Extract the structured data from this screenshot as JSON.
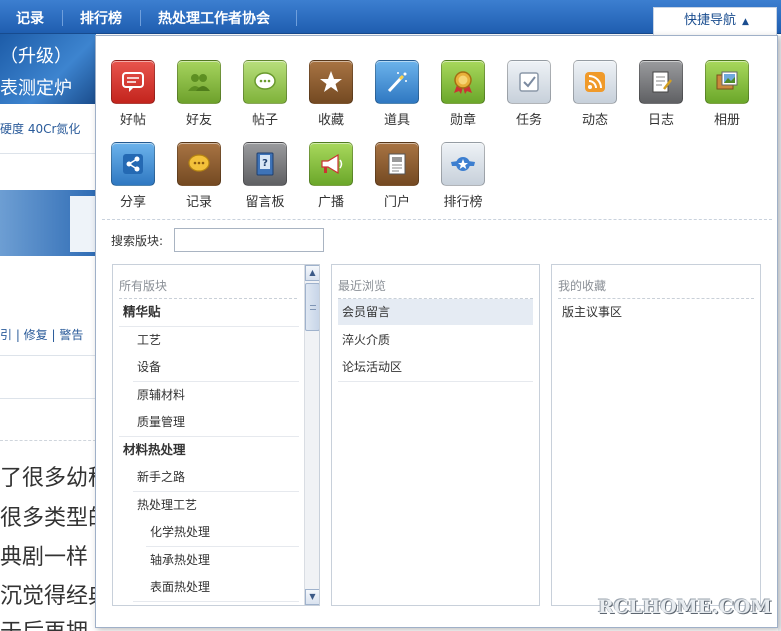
{
  "topnav": {
    "items": [
      "记录",
      "排行榜",
      "热处理工作者协会"
    ],
    "quicknav_label": "快捷导航",
    "quicknav_caret": "▲"
  },
  "background": {
    "banner_line1": "（升级）",
    "banner_line2": "表测定炉",
    "hardness_text": "硬度  40Cr氮化",
    "post_actions": "引 | 修复 | 警告",
    "big_lines": [
      "了很多幼稚",
      "很多类型的",
      "典剧一样",
      "沉觉得经典",
      "于后再拥"
    ]
  },
  "popup": {
    "icons": [
      {
        "label": "好帖",
        "icon": "speech-bubble-icon",
        "color": "#d9342c"
      },
      {
        "label": "好友",
        "icon": "friends-icon",
        "color": "#7ab33b"
      },
      {
        "label": "帖子",
        "icon": "chat-bubble-icon",
        "color": "#8cc34a"
      },
      {
        "label": "收藏",
        "icon": "star-icon",
        "color": "#8a5a2b"
      },
      {
        "label": "道具",
        "icon": "magic-wand-icon",
        "color": "#3f8fd6"
      },
      {
        "label": "勋章",
        "icon": "medal-icon",
        "color": "#86c23f"
      },
      {
        "label": "任务",
        "icon": "task-check-icon",
        "color": "#c9d2dc"
      },
      {
        "label": "动态",
        "icon": "rss-feed-icon",
        "color": "#c9d2dc"
      },
      {
        "label": "日志",
        "icon": "notebook-icon",
        "color": "#7e7f82"
      },
      {
        "label": "相册",
        "icon": "photo-album-icon",
        "color": "#86c23f"
      },
      {
        "label": "分享",
        "icon": "share-icon",
        "color": "#3f8fd6"
      },
      {
        "label": "记录",
        "icon": "record-bubble-icon",
        "color": "#8a5a2b"
      },
      {
        "label": "留言板",
        "icon": "message-board-icon",
        "color": "#7e7f82"
      },
      {
        "label": "广播",
        "icon": "megaphone-icon",
        "color": "#86c23f"
      },
      {
        "label": "门户",
        "icon": "portal-doc-icon",
        "color": "#8a5a2b"
      },
      {
        "label": "排行榜",
        "icon": "ranking-star-icon",
        "color": "#c9d2dc"
      }
    ],
    "search_label": "搜索版块:",
    "search_value": "",
    "all_forums": {
      "title": "所有版块",
      "rows": [
        {
          "label": "精华贴",
          "level": 0
        },
        {
          "label": "工艺",
          "level": 1
        },
        {
          "label": "设备",
          "level": 1
        },
        {
          "label": "原辅材料",
          "level": 1
        },
        {
          "label": "质量管理",
          "level": 1
        },
        {
          "label": "材料热处理",
          "level": 0
        },
        {
          "label": "新手之路",
          "level": 1
        },
        {
          "label": "热处理工艺",
          "level": 1
        },
        {
          "label": "化学热处理",
          "level": 2
        },
        {
          "label": "轴承热处理",
          "level": 2
        },
        {
          "label": "表面热处理",
          "level": 2
        }
      ]
    },
    "recent": {
      "title": "最近浏览",
      "rows": [
        "会员留言",
        "淬火介质",
        "论坛活动区"
      ]
    },
    "favorites": {
      "title": "我的收藏",
      "rows": [
        "版主议事区"
      ]
    }
  },
  "watermark": "RCLHOME.COM"
}
